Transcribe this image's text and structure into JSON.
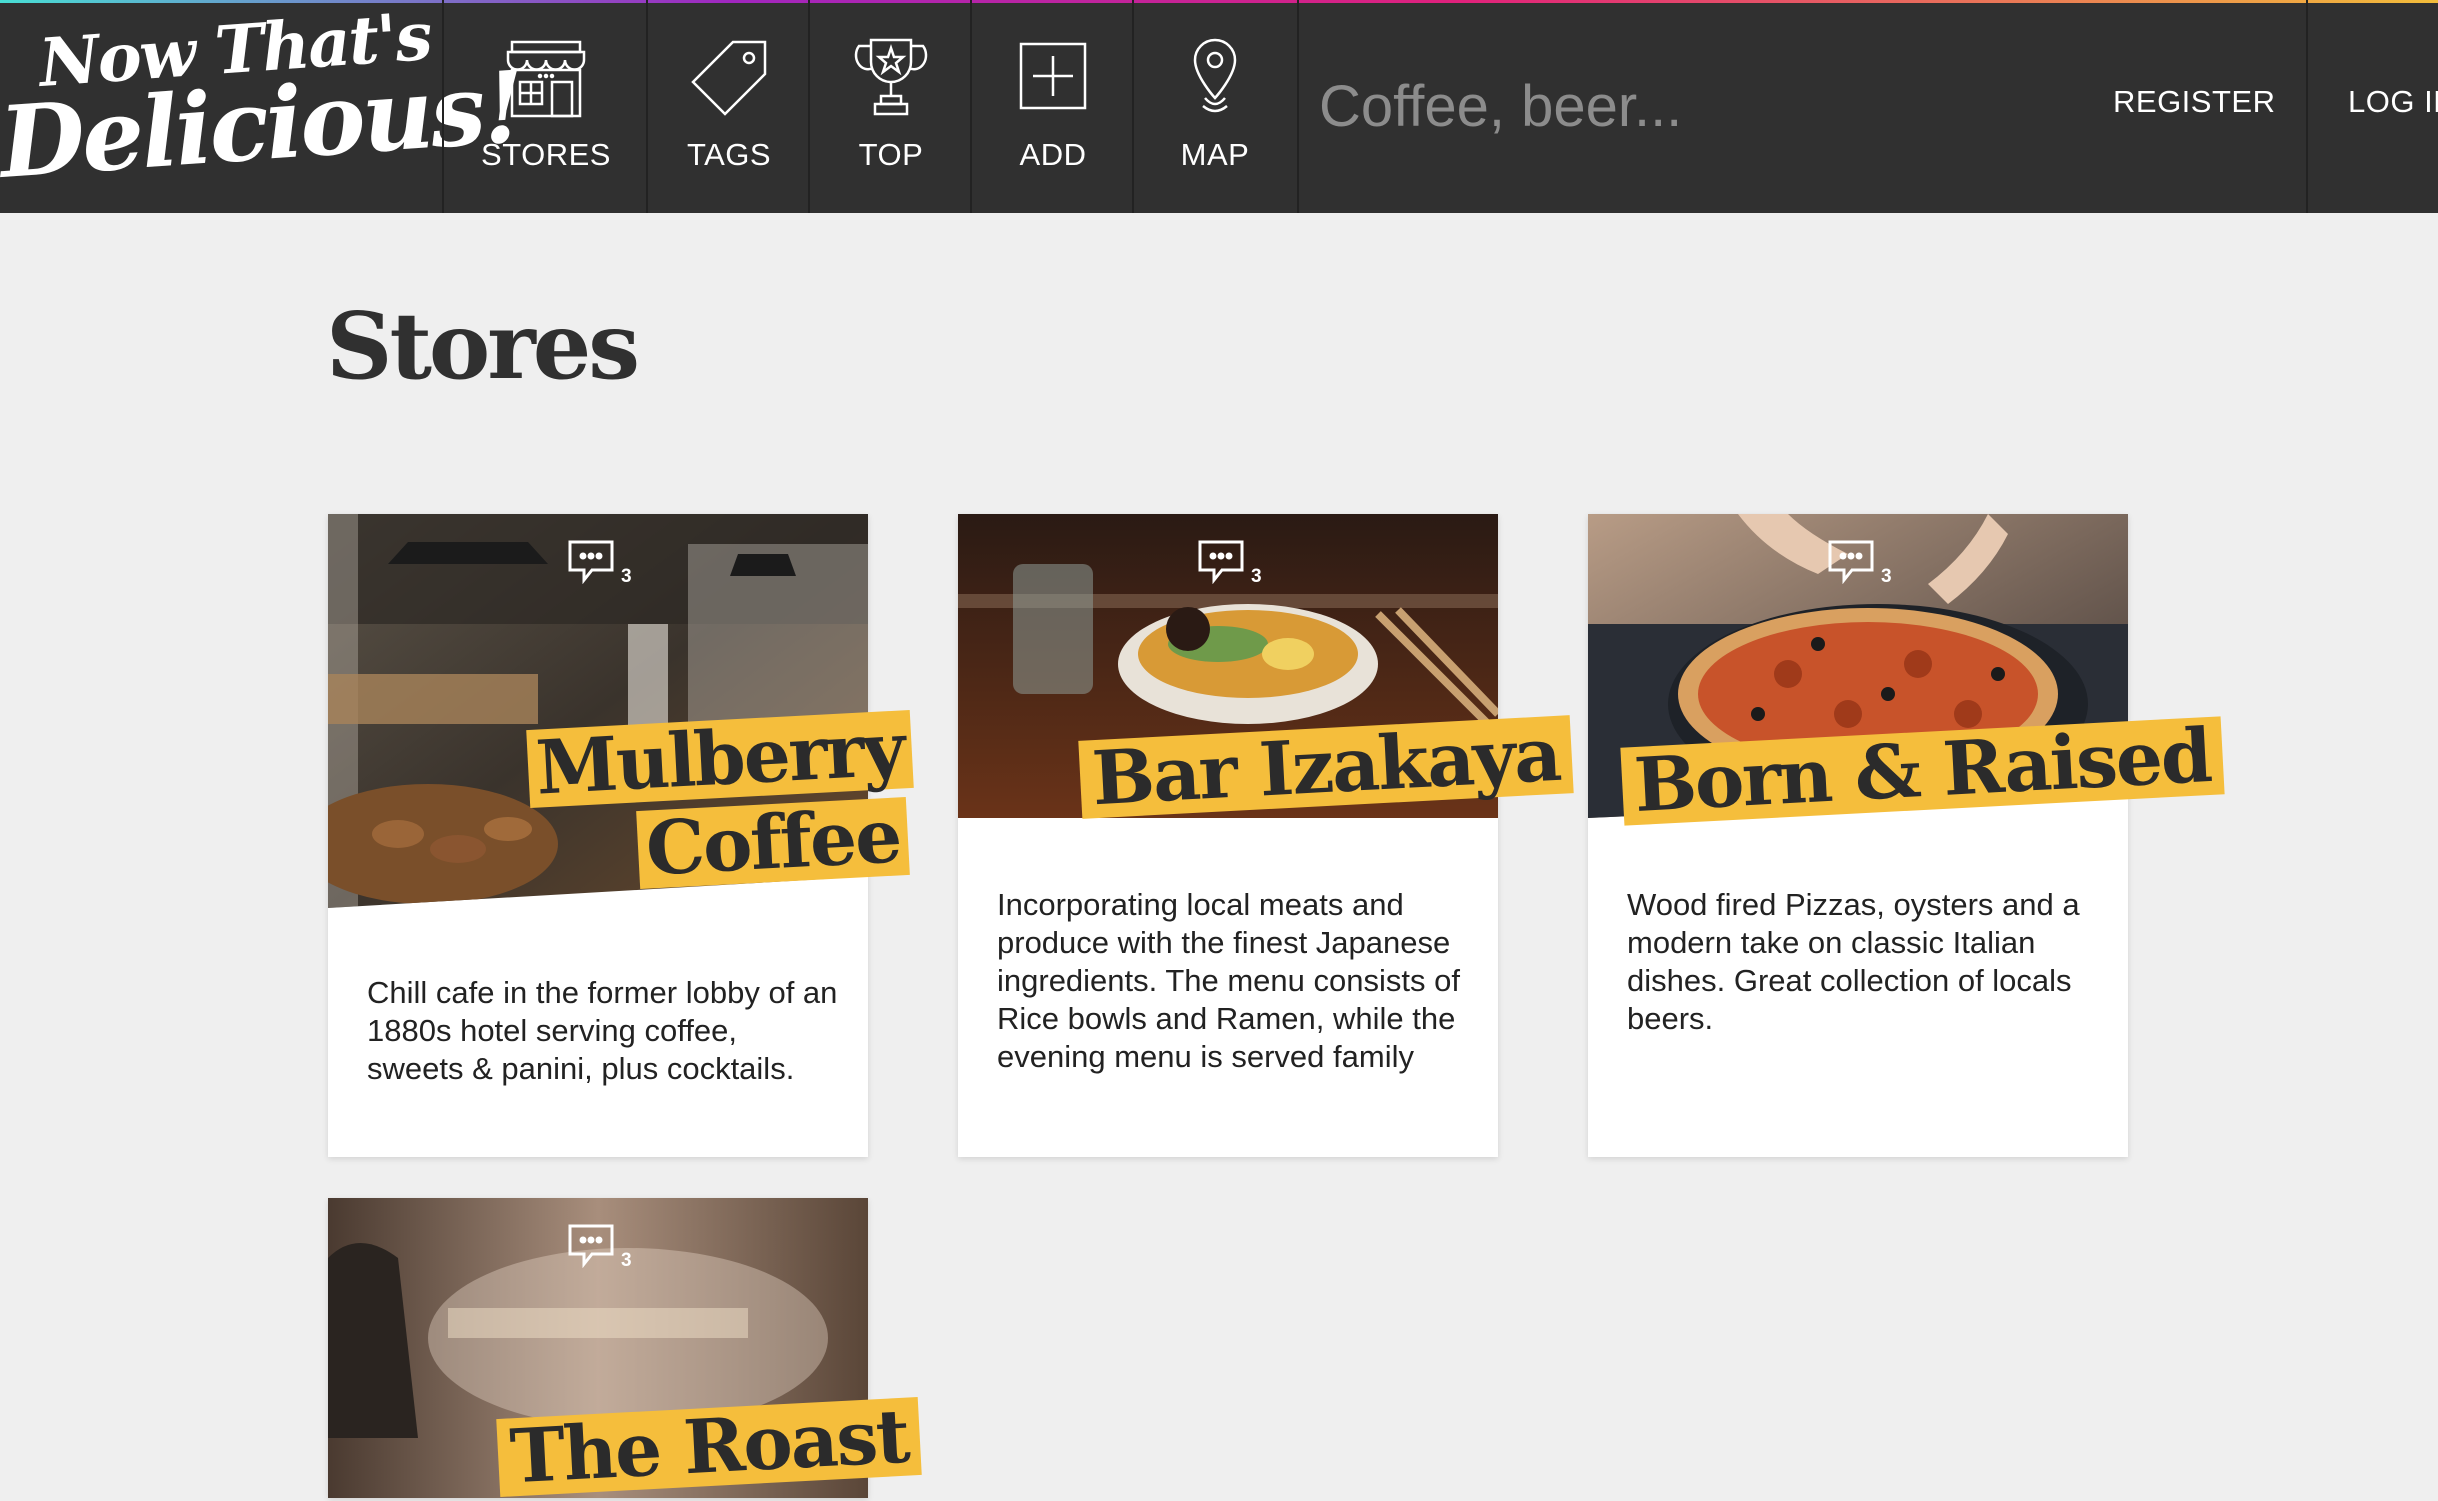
{
  "nav": {
    "logo_line1": "Now That's",
    "logo_line2": "Delicious!",
    "items": [
      {
        "label": "STORES",
        "icon": "store-icon"
      },
      {
        "label": "TAGS",
        "icon": "tag-icon"
      },
      {
        "label": "TOP",
        "icon": "trophy-icon"
      },
      {
        "label": "ADD",
        "icon": "add-icon"
      },
      {
        "label": "MAP",
        "icon": "map-pin-icon"
      }
    ],
    "search_placeholder": "Coffee, beer...",
    "register_label": "REGISTER",
    "login_label": "LOG IN"
  },
  "page": {
    "title": "Stores"
  },
  "stores": [
    {
      "name_line1": "Mulberry",
      "name_line2": "Coffee",
      "comment_count": "3",
      "description": "Chill cafe in the former lobby of an 1880s hotel serving coffee, sweets & panini, plus cocktails."
    },
    {
      "name_line1": "Bar Izakaya",
      "comment_count": "3",
      "description": "Incorporating local meats and produce with the finest Japanese ingredients. The menu consists of Rice bowls and Ramen, while the evening menu is served family"
    },
    {
      "name_line1": "Born & Raised",
      "comment_count": "3",
      "description": "Wood fired Pizzas, oysters and a modern take on classic Italian dishes. Great collection of locals beers."
    },
    {
      "name_line1": "The Roast",
      "comment_count": "3",
      "description": ""
    }
  ],
  "colors": {
    "nav_bg": "#303030",
    "page_bg": "#efefef",
    "accent_yellow": "#f5be3c"
  }
}
